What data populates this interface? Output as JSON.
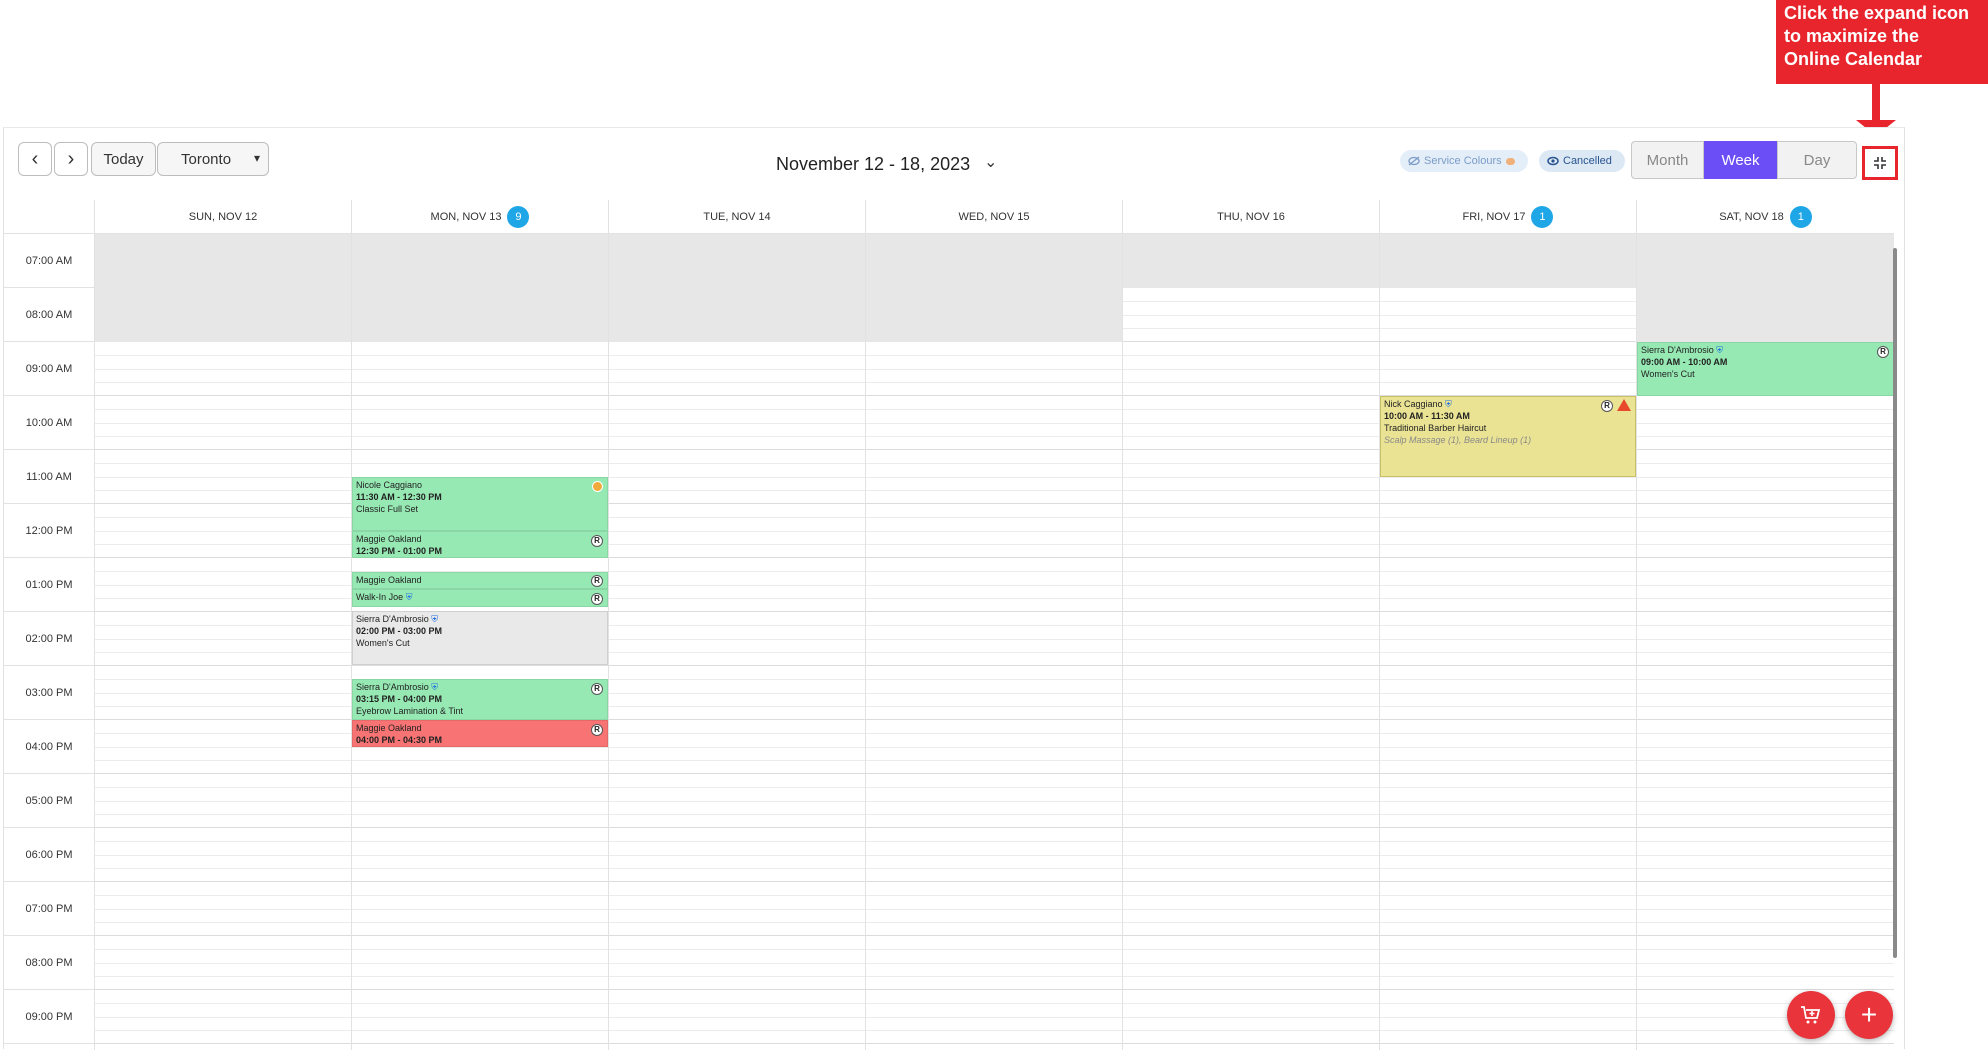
{
  "callout": {
    "text": "Click the expand icon to maximize the Online Calendar"
  },
  "toolbar": {
    "prev_icon": "chevron-left-icon",
    "next_icon": "chevron-right-icon",
    "today_label": "Today",
    "location_value": "Toronto",
    "date_range": "November 12 - 18, 2023",
    "service_colours_label": "Service Colours",
    "cancelled_label": "Cancelled",
    "view_month": "Month",
    "view_week": "Week",
    "view_day": "Day",
    "active_view": "Week",
    "expand_icon": "compress-icon"
  },
  "days": [
    {
      "label": "SUN, NOV 12",
      "count": ""
    },
    {
      "label": "MON, NOV 13",
      "count": "9"
    },
    {
      "label": "TUE, NOV 14",
      "count": ""
    },
    {
      "label": "WED, NOV 15",
      "count": ""
    },
    {
      "label": "THU, NOV 16",
      "count": ""
    },
    {
      "label": "FRI, NOV 17",
      "count": "1"
    },
    {
      "label": "SAT, NOV 18",
      "count": "1"
    }
  ],
  "hours": [
    "07:00 AM",
    "08:00 AM",
    "09:00 AM",
    "10:00 AM",
    "11:00 AM",
    "12:00 PM",
    "01:00 PM",
    "02:00 PM",
    "03:00 PM",
    "04:00 PM",
    "05:00 PM",
    "06:00 PM",
    "07:00 PM",
    "08:00 PM",
    "09:00 PM"
  ],
  "events": {
    "nicole": {
      "name": "Nicole Caggiano",
      "time": "11:30 AM - 12:30 PM",
      "service": "Classic Full Set"
    },
    "maggie1": {
      "name": "Maggie Oakland",
      "time": "12:30 PM - 01:00 PM",
      "tag": "R"
    },
    "maggie2": {
      "name": "Maggie Oakland",
      "tag": "R"
    },
    "walkin": {
      "name": "Walk-In Joe",
      "tag": "R"
    },
    "sierra_mon_1": {
      "name": "Sierra D'Ambrosio",
      "time": "02:00 PM - 03:00 PM",
      "service": "Women's Cut"
    },
    "sierra_mon_2": {
      "name": "Sierra D'Ambrosio",
      "time": "03:15 PM - 04:00 PM",
      "service": "Eyebrow Lamination & Tint",
      "tag": "R"
    },
    "maggie3": {
      "name": "Maggie Oakland",
      "time": "04:00 PM - 04:30 PM",
      "tag": "R"
    },
    "nick": {
      "name": "Nick Caggiano",
      "time": "10:00 AM - 11:30 AM",
      "service": "Traditional Barber Haircut",
      "addons": "Scalp Massage (1), Beard Lineup (1)",
      "tag": "R"
    },
    "sierra_sat": {
      "name": "Sierra D'Ambrosio",
      "time": "09:00 AM - 10:00 AM",
      "service": "Women's Cut",
      "tag": "R"
    }
  },
  "fabs": {
    "cart_icon": "cart-plus-icon",
    "add_icon": "plus-icon"
  },
  "colors": {
    "accent": "#6b4ef5",
    "appointment_green": "#96e9b3",
    "cancelled_red": "#f87373",
    "warning_yellow": "#eae394",
    "badge_blue": "#1fa6e6",
    "callout_red": "#e8242c"
  }
}
